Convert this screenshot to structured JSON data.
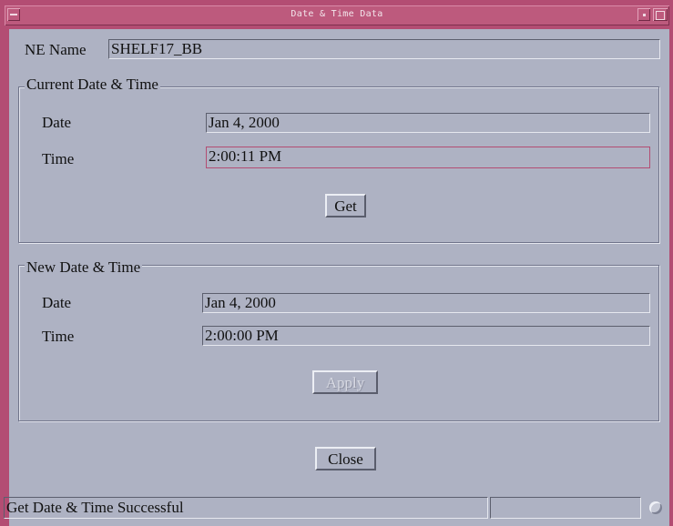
{
  "window": {
    "title": "Date & Time Data"
  },
  "ne": {
    "label": "NE Name",
    "value": "SHELF17_BB"
  },
  "current": {
    "legend": "Current Date & Time",
    "date_label": "Date",
    "date_value": "Jan 4, 2000",
    "time_label": "Time",
    "time_value": "2:00:11 PM",
    "get_label": "Get"
  },
  "new": {
    "legend": "New Date & Time",
    "date_label": "Date",
    "date_value": "Jan 4, 2000",
    "time_label": "Time",
    "time_value": "2:00:00 PM",
    "apply_label": "Apply"
  },
  "close_label": "Close",
  "status": {
    "message": "Get Date & Time  Successful",
    "secondary": ""
  },
  "colors": {
    "title_bar": "#bd5a7d",
    "client_bg": "#aeb2c3",
    "focus_border": "#b34d73"
  },
  "icons": {
    "window_menu": "window-menu-icon",
    "minimize": "minimize-icon",
    "maximize": "maximize-icon",
    "resize": "resize-grip-icon"
  }
}
